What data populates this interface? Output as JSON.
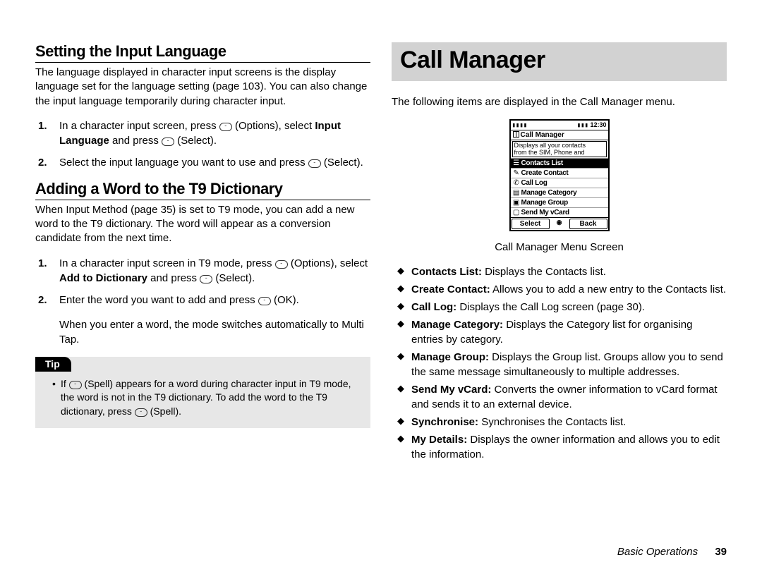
{
  "left": {
    "heading1": "Setting the Input Language",
    "p1": "The language displayed in character input screens is the display language set for the language setting (page 103). You can also change the input language temporarily during character input.",
    "step1_a": "In a character input screen, press ",
    "step1_b": " (Options), select ",
    "step1_bold": "Input Language",
    "step1_c": " and press ",
    "step1_d": " (Select).",
    "step2_a": "Select the input language you want to use and press ",
    "step2_b": " (Select).",
    "heading2": "Adding a Word to the T9 Dictionary",
    "p2": "When Input Method (page 35) is set to T9 mode, you can add a new word to the T9 dictionary. The word will appear as a conversion candidate from the next time.",
    "t9_step1_a": "In a character input screen in T9 mode, press ",
    "t9_step1_b": " (Options), select ",
    "t9_step1_bold": "Add to Dictionary",
    "t9_step1_c": " and press ",
    "t9_step1_d": " (Select).",
    "t9_step2_a": "Enter the word you want to add and press ",
    "t9_step2_b": " (OK).",
    "t9_note": "When you enter a word, the mode switches automatically to Multi Tap.",
    "tip_label": "Tip",
    "tip_a": "If ",
    "tip_b": " (Spell) appears for a word during character input in T9 mode, the word is not in the T9 dictionary. To add the word to the T9 dictionary, press ",
    "tip_c": " (Spell)."
  },
  "right": {
    "title": "Call Manager",
    "intro": "The following items are displayed in the Call Manager menu.",
    "phone": {
      "time": "12:30",
      "title": "Call Manager",
      "desc_l1": "Displays all your contacts",
      "desc_l2": "from the SIM, Phone and",
      "items": [
        "Contacts List",
        "Create Contact",
        "Call Log",
        "Manage Category",
        "Manage Group",
        "Send My vCard"
      ],
      "soft_left": "Select",
      "soft_right": "Back"
    },
    "caption": "Call Manager Menu Screen",
    "bullets": [
      {
        "b": "Contacts List:",
        "t": " Displays the Contacts list."
      },
      {
        "b": "Create Contact:",
        "t": " Allows you to add a new entry to the Contacts list."
      },
      {
        "b": "Call Log:",
        "t": " Displays the Call Log screen (page 30)."
      },
      {
        "b": "Manage Category:",
        "t": " Displays the Category list for organising entries by category."
      },
      {
        "b": "Manage Group:",
        "t": " Displays the Group list. Groups allow you to send the same message simultaneously to multiple addresses."
      },
      {
        "b": "Send My vCard:",
        "t": " Converts the owner information to vCard format and sends it to an external device."
      },
      {
        "b": "Synchronise:",
        "t": " Synchronises the Contacts list."
      },
      {
        "b": "My Details:",
        "t": " Displays the owner information and allows you to edit the information."
      }
    ]
  },
  "footer": {
    "section": "Basic Operations",
    "page": "39"
  }
}
